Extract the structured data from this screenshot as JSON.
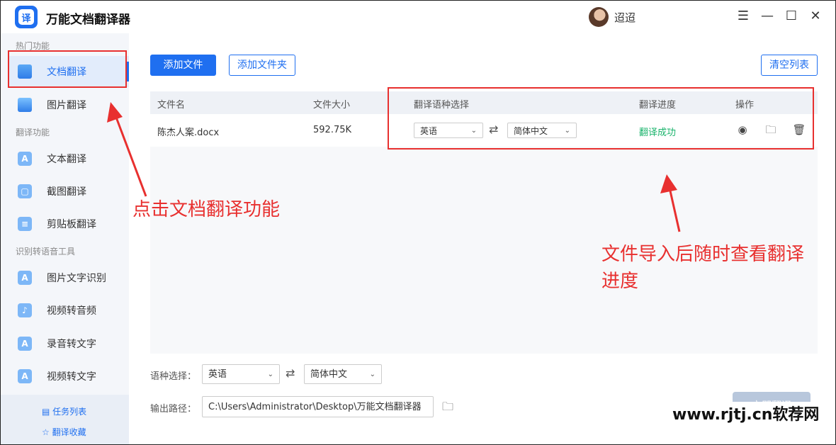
{
  "app": {
    "title": "万能文档翻译器",
    "logo_char": "译",
    "username": "迢迢",
    "window_controls": [
      "menu-icon",
      "minimize-icon",
      "maximize-icon",
      "close-icon"
    ]
  },
  "sidebar": {
    "sections": [
      {
        "title": "热门功能",
        "items": [
          {
            "label": "文档翻译",
            "icon": "document-icon",
            "active": true
          },
          {
            "label": "图片翻译",
            "icon": "image-icon"
          }
        ]
      },
      {
        "title": "翻译功能",
        "items": [
          {
            "label": "文本翻译",
            "icon": "text-a-icon"
          },
          {
            "label": "截图翻译",
            "icon": "screenshot-icon"
          },
          {
            "label": "剪贴板翻译",
            "icon": "clipboard-icon"
          }
        ]
      },
      {
        "title": "识别转语音工具",
        "items": [
          {
            "label": "图片文字识别",
            "icon": "ocr-icon"
          },
          {
            "label": "视频转音频",
            "icon": "video-audio-icon"
          },
          {
            "label": "录音转文字",
            "icon": "record-text-icon"
          },
          {
            "label": "视频转文字",
            "icon": "video-text-icon"
          }
        ]
      }
    ],
    "bottom_links": [
      "任务列表",
      "翻译收藏"
    ]
  },
  "toolbar": {
    "add_file": "添加文件",
    "add_folder": "添加文件夹",
    "clear_list": "清空列表"
  },
  "table": {
    "headers": [
      "文件名",
      "文件大小",
      "翻译语种选择",
      "翻译进度",
      "操作"
    ],
    "rows": [
      {
        "filename": "陈杰人案.docx",
        "size": "592.75K",
        "source_lang": "英语",
        "target_lang": "简体中文",
        "progress": "翻译成功",
        "actions": [
          "preview-icon",
          "folder-icon",
          "trash-icon"
        ]
      }
    ]
  },
  "settings": {
    "lang_label": "语种选择：",
    "source_lang": "英语",
    "target_lang": "简体中文",
    "output_label": "输出路径：",
    "output_path": "C:\\Users\\Administrator\\Desktop\\万能文档翻译器",
    "start_button": "立即翻译"
  },
  "annotations": {
    "left_note": "点击文档翻译功能",
    "right_note_line1": "文件导入后随时查看翻译",
    "right_note_line2": "进度",
    "color": "#e8302f"
  },
  "watermark": "www.rjtj.cn软荐网",
  "colors": {
    "accent": "#1f6ff0",
    "success": "#19b36b",
    "annotation": "#e8302f"
  }
}
